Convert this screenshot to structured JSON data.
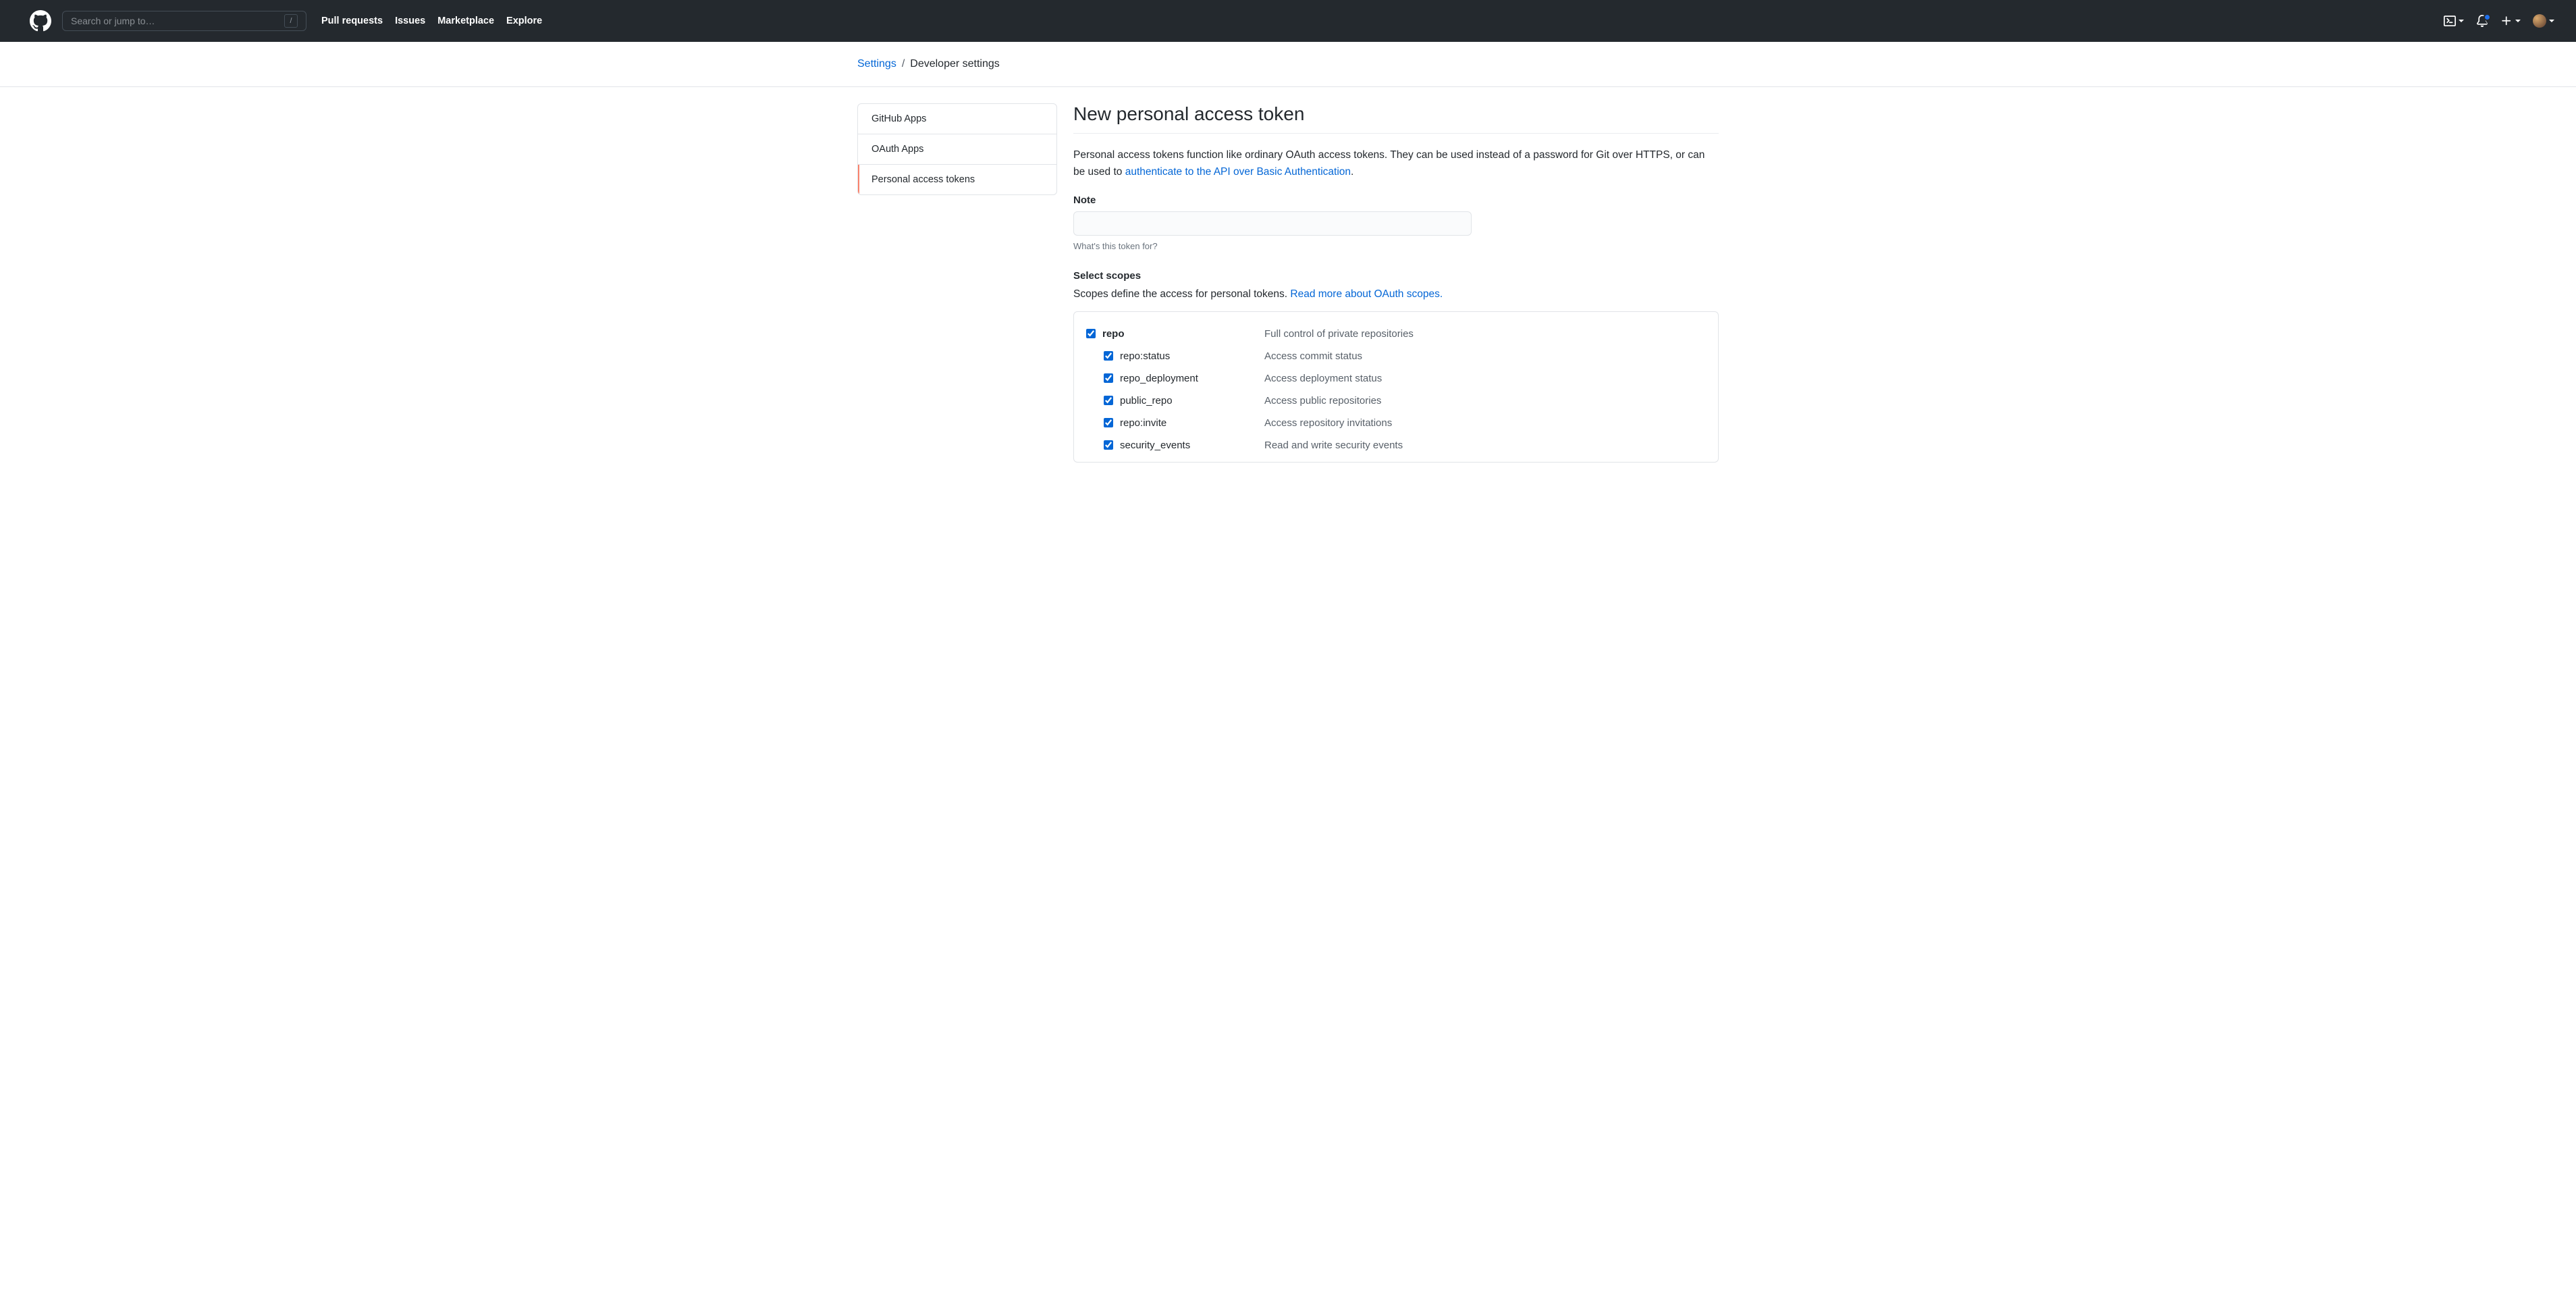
{
  "header": {
    "search_placeholder": "Search or jump to…",
    "slash_hint": "/",
    "nav": [
      "Pull requests",
      "Issues",
      "Marketplace",
      "Explore"
    ]
  },
  "breadcrumb": {
    "root": "Settings",
    "sep": "/",
    "current": "Developer settings"
  },
  "sidenav": {
    "items": [
      "GitHub Apps",
      "OAuth Apps",
      "Personal access tokens"
    ]
  },
  "main": {
    "title": "New personal access token",
    "desc_before": "Personal access tokens function like ordinary OAuth access tokens. They can be used instead of a password for Git over HTTPS, or can be used to ",
    "desc_link": "authenticate to the API over Basic Authentication",
    "desc_after": ".",
    "note_label": "Note",
    "note_value": "",
    "note_hint": "What's this token for?",
    "scopes_label": "Select scopes",
    "scopes_desc_before": "Scopes define the access for personal tokens. ",
    "scopes_desc_link": "Read more about OAuth scopes.",
    "scopes": {
      "parent": {
        "name": "repo",
        "desc": "Full control of private repositories",
        "checked": true
      },
      "children": [
        {
          "name": "repo:status",
          "desc": "Access commit status",
          "checked": true
        },
        {
          "name": "repo_deployment",
          "desc": "Access deployment status",
          "checked": true
        },
        {
          "name": "public_repo",
          "desc": "Access public repositories",
          "checked": true
        },
        {
          "name": "repo:invite",
          "desc": "Access repository invitations",
          "checked": true
        },
        {
          "name": "security_events",
          "desc": "Read and write security events",
          "checked": true
        }
      ]
    }
  }
}
